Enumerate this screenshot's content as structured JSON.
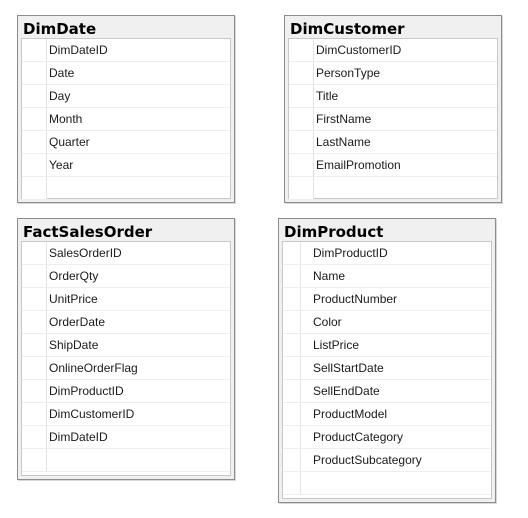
{
  "tables": {
    "dimdate": {
      "title": "DimDate",
      "columns": [
        "DimDateID",
        "Date",
        "Day",
        "Month",
        "Quarter",
        "Year"
      ]
    },
    "dimcustomer": {
      "title": "DimCustomer",
      "columns": [
        "DimCustomerID",
        "PersonType",
        "Title",
        "FirstName",
        "LastName",
        "EmailPromotion"
      ]
    },
    "factsalesorder": {
      "title": "FactSalesOrder",
      "columns": [
        "SalesOrderID",
        "OrderQty",
        "UnitPrice",
        "OrderDate",
        "ShipDate",
        "OnlineOrderFlag",
        "DimProductID",
        "DimCustomerID",
        "DimDateID"
      ]
    },
    "dimproduct": {
      "title": "DimProduct",
      "columns": [
        "DimProductID",
        "Name",
        "ProductNumber",
        "Color",
        "ListPrice",
        "SellStartDate",
        "SellEndDate",
        "ProductModel",
        "ProductCategory",
        "ProductSubcategory"
      ]
    }
  }
}
